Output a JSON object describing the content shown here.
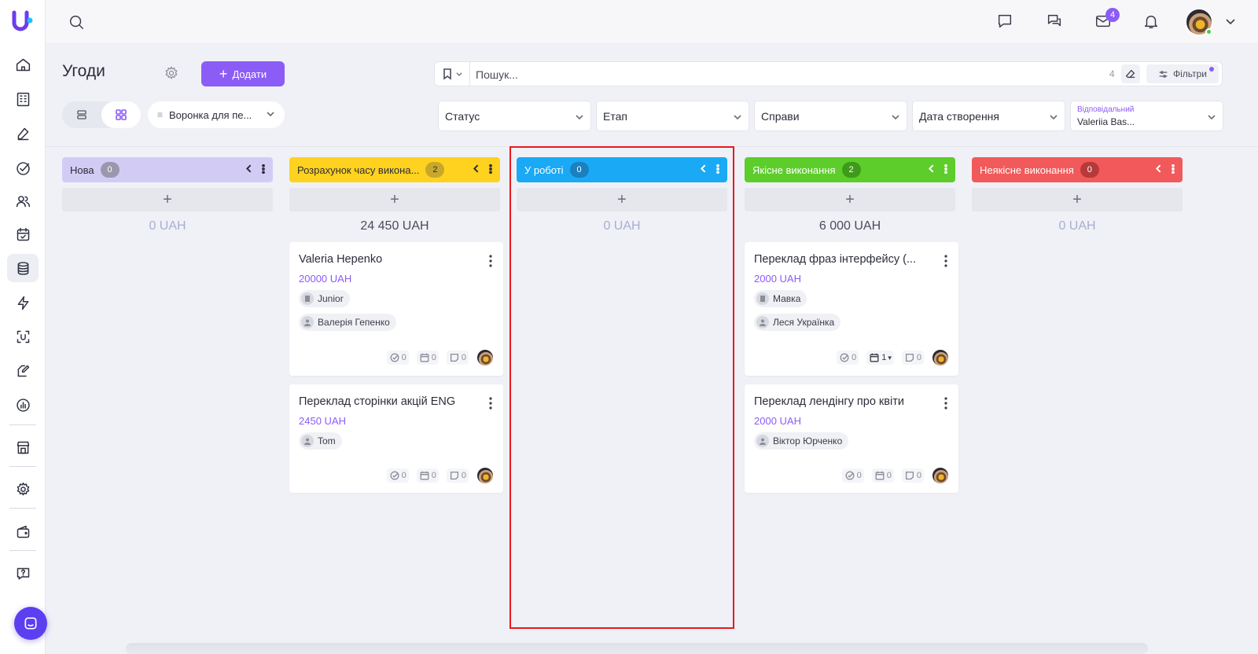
{
  "sidebar": {
    "logo": "unicode-u-logo",
    "items": [
      {
        "icon": "home-icon"
      },
      {
        "icon": "building-icon"
      },
      {
        "icon": "signature-icon"
      },
      {
        "icon": "check-circle-icon"
      },
      {
        "icon": "users-icon"
      },
      {
        "icon": "calendar-check-icon"
      },
      {
        "icon": "coins-stack-icon",
        "active": true
      },
      {
        "icon": "lightning-icon"
      },
      {
        "icon": "scan-icon"
      },
      {
        "icon": "document-edit-icon"
      },
      {
        "icon": "chart-icon"
      },
      {
        "icon": "store-icon"
      },
      {
        "icon": "settings-icon"
      },
      {
        "icon": "wallet-icon"
      },
      {
        "icon": "help-icon"
      }
    ],
    "chat_button_icon": "chat-bubble-icon"
  },
  "topbar": {
    "search_icon": "search-icon",
    "icons": [
      "message-icon",
      "chats-icon",
      "mail-icon",
      "bell-icon"
    ],
    "mail_badge": "4",
    "user_avatar": "user-avatar",
    "menu_icon": "chevron-down-icon"
  },
  "header": {
    "title": "Угоди",
    "add_button": "Додати",
    "funnel_select": "Воронка для пе...",
    "search_placeholder": "Пошук...",
    "search_value": "",
    "search_count": "4",
    "filters_button": "Фільтри",
    "filters": [
      {
        "label": "Статус"
      },
      {
        "label": "Етап"
      },
      {
        "label": "Справи"
      },
      {
        "label": "Дата створення"
      }
    ],
    "responsible": {
      "label": "Відповідальний",
      "value": "Valeriia Bas..."
    }
  },
  "columns": [
    {
      "name": "Нова",
      "count": "0",
      "total": "0 UAH",
      "color": "#d2ccf5",
      "text_color": "#2b2d3a",
      "count_bg": "#9b98ad",
      "count_color": "#ffffff"
    },
    {
      "name": "Розрахунок часу викона...",
      "count": "2",
      "total": "24 450 UAH",
      "color": "#ffd21f",
      "text_color": "#2b2d3a",
      "count_bg": "#c8a82a",
      "count_color": "#2b2d3a"
    },
    {
      "name": "У роботі",
      "count": "0",
      "total": "0 UAH",
      "color": "#1aa9f5",
      "text_color": "#ffffff",
      "count_bg": "#1b7fc0",
      "count_color": "#ffffff"
    },
    {
      "name": "Якісне виконання",
      "count": "2",
      "total": "6 000 UAH",
      "color": "#5ccd2a",
      "text_color": "#ffffff",
      "count_bg": "#3e9a1a",
      "count_color": "#ffffff"
    },
    {
      "name": "Неякісне виконання",
      "count": "0",
      "total": "0 UAH",
      "color": "#f2595a",
      "text_color": "#ffffff",
      "count_bg": "#b73a3a",
      "count_color": "#ffffff"
    }
  ],
  "cards": {
    "c1": {
      "title": "Valeria Hepenko",
      "amount": "20000 UAH",
      "chip1": "Junior",
      "chip2": "Валерія Гепенко",
      "tasks": "0",
      "events": "0",
      "notes": "0"
    },
    "c2": {
      "title": "Переклад сторінки акцій ENG",
      "amount": "2450 UAH",
      "chip1": "Tom",
      "tasks": "0",
      "events": "0",
      "notes": "0"
    },
    "c3": {
      "title": "Переклад фраз інтерфейсу (...",
      "amount": "2000 UAH",
      "chip1": "Мавка",
      "chip2": "Леся Українка",
      "tasks": "0",
      "events": "1",
      "notes": "0"
    },
    "c4": {
      "title": "Переклад лендінгу про квіти",
      "amount": "2000 UAH",
      "chip1": "Віктор Юрченко",
      "tasks": "0",
      "events": "0",
      "notes": "0"
    }
  }
}
